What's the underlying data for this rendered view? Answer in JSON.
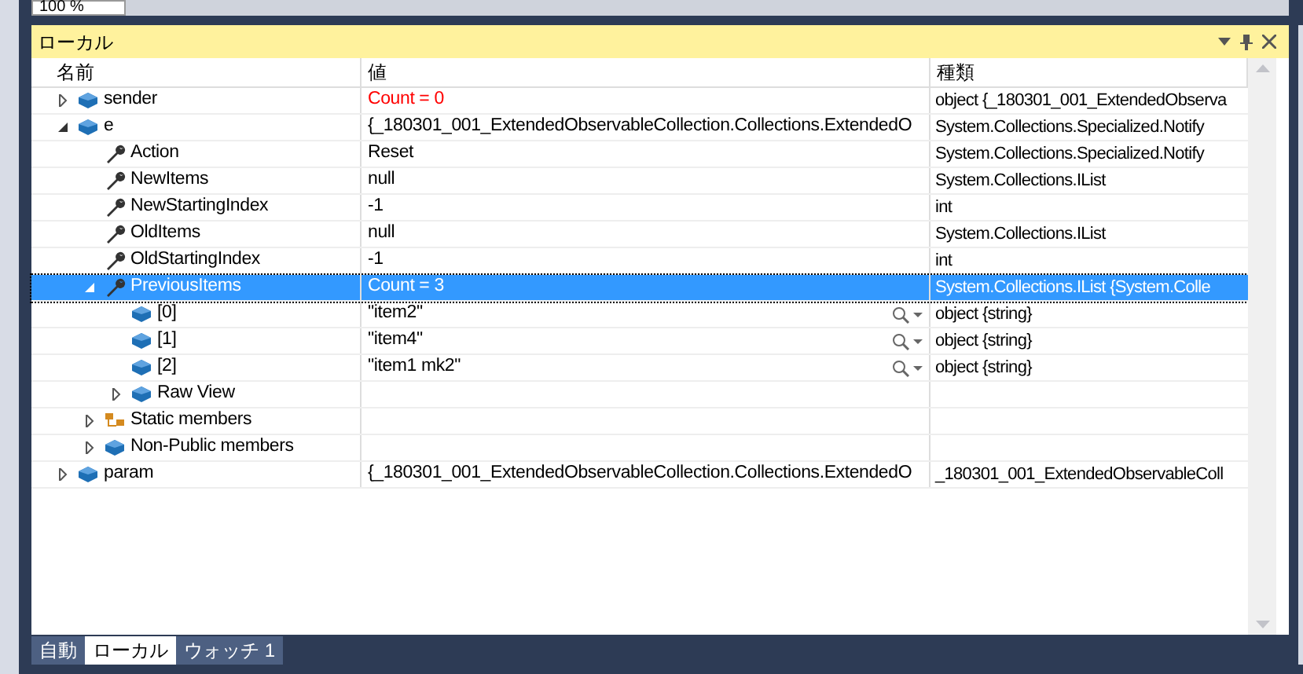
{
  "zoom_box": {
    "value": "100 %"
  },
  "panel": {
    "title": "ローカル"
  },
  "columns": [
    "名前",
    "値",
    "種類"
  ],
  "rows": [
    {
      "name": "sender",
      "value": "Count = 0",
      "type": "object {_180301_001_ExtendedObserva",
      "kind": "field",
      "expanded": false,
      "changed": true,
      "selected": false
    },
    {
      "name": "e",
      "value": "{_180301_001_ExtendedObservableCollection.Collections.ExtendedO",
      "type": "System.Collections.Specialized.Notify",
      "kind": "field",
      "expanded": true,
      "changed": false,
      "selected": false,
      "children": [
        {
          "name": "Action",
          "value": "Reset",
          "type": "System.Collections.Specialized.Notify",
          "kind": "property",
          "changed": false,
          "selected": false
        },
        {
          "name": "NewItems",
          "value": "null",
          "type": "System.Collections.IList",
          "kind": "property",
          "changed": false,
          "selected": false
        },
        {
          "name": "NewStartingIndex",
          "value": "-1",
          "type": "int",
          "kind": "property",
          "changed": false,
          "selected": false
        },
        {
          "name": "OldItems",
          "value": "null",
          "type": "System.Collections.IList",
          "kind": "property",
          "changed": false,
          "selected": false
        },
        {
          "name": "OldStartingIndex",
          "value": "-1",
          "type": "int",
          "kind": "property",
          "changed": false,
          "selected": false
        },
        {
          "name": "PreviousItems",
          "value": "Count = 3",
          "type": "System.Collections.IList {System.Colle",
          "kind": "property",
          "expanded": true,
          "changed": false,
          "selected": true,
          "children": [
            {
              "name": "[0]",
              "value": "\"item2\"",
              "type": "object {string}",
              "kind": "field",
              "changed": false,
              "selected": false,
              "visualizer": true
            },
            {
              "name": "[1]",
              "value": "\"item4\"",
              "type": "object {string}",
              "kind": "field",
              "changed": false,
              "selected": false,
              "visualizer": true
            },
            {
              "name": "[2]",
              "value": "\"item1 mk2\"",
              "type": "object {string}",
              "kind": "field",
              "changed": false,
              "selected": false,
              "visualizer": true
            },
            {
              "name": "Raw View",
              "kind": "field",
              "expanded": false,
              "selected": false
            }
          ]
        },
        {
          "name": "Static members",
          "kind": "static",
          "expanded": false,
          "selected": false
        },
        {
          "name": "Non-Public members",
          "kind": "field",
          "expanded": false,
          "selected": false
        }
      ]
    },
    {
      "name": "param",
      "value": "{_180301_001_ExtendedObservableCollection.Collections.ExtendedO",
      "type": "_180301_001_ExtendedObservableColl",
      "kind": "field",
      "expanded": false,
      "changed": false,
      "selected": false
    }
  ],
  "tabs": [
    {
      "label": "自動",
      "selected": false
    },
    {
      "label": "ローカル",
      "selected": true
    },
    {
      "label": "ウォッチ 1",
      "selected": false
    }
  ]
}
